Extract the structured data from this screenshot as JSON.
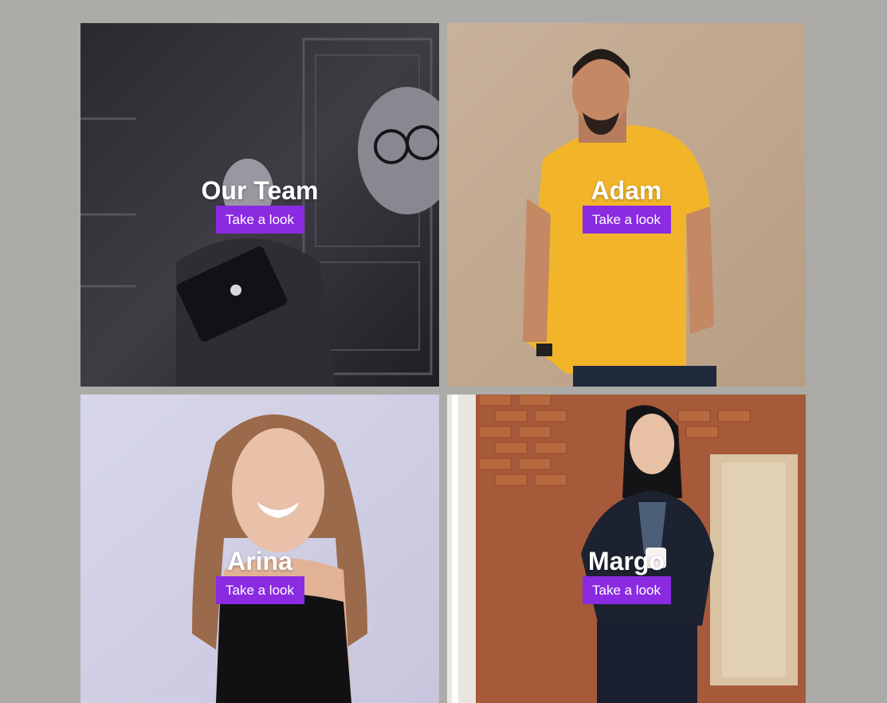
{
  "cards": [
    {
      "name": "Our Team",
      "button_label": "Take a look",
      "tone": "dark"
    },
    {
      "name": "Adam",
      "button_label": "Take a look",
      "tone": "beige"
    },
    {
      "name": "Arina",
      "button_label": "Take a look",
      "tone": "lavender"
    },
    {
      "name": "Margo",
      "button_label": "Take a look",
      "tone": "brick"
    }
  ],
  "colors": {
    "page_background": "#acaba7",
    "button_background": "#8a2be2",
    "button_text": "#ffffff",
    "heading_text": "#ffffff"
  }
}
